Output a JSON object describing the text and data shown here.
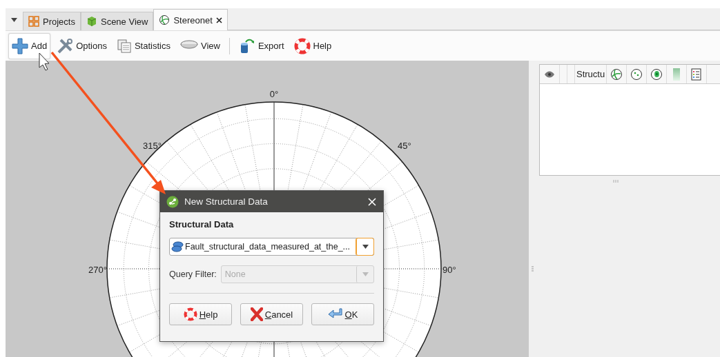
{
  "tabs": [
    {
      "label": "Projects",
      "kind": "projects",
      "selected": false
    },
    {
      "label": "Scene View",
      "kind": "scene",
      "selected": false
    },
    {
      "label": "Stereonet",
      "kind": "stereonet",
      "selected": true
    }
  ],
  "toolbar": [
    {
      "label": "Add",
      "kind": "add",
      "hovered": true,
      "separator_before": false
    },
    {
      "label": "Options",
      "kind": "options",
      "hovered": false,
      "separator_before": false
    },
    {
      "label": "Statistics",
      "kind": "statistics",
      "hovered": false,
      "separator_before": false
    },
    {
      "label": "View",
      "kind": "view",
      "hovered": false,
      "separator_before": false
    },
    {
      "label": "Export",
      "kind": "export",
      "hovered": false,
      "separator_before": true
    },
    {
      "label": "Help",
      "kind": "help",
      "hovered": false,
      "separator_before": false
    }
  ],
  "stereonet": {
    "labels": [
      {
        "text": "0°",
        "kind": "n"
      },
      {
        "text": "45°",
        "kind": "ne"
      },
      {
        "text": "315°",
        "kind": "nw"
      },
      {
        "text": "270°",
        "kind": "w"
      },
      {
        "text": "90°",
        "kind": "e"
      }
    ]
  },
  "side_panel": {
    "header": "Structu"
  },
  "dialog": {
    "title": "New Structural Data",
    "section": "Structural Data",
    "structural_data": {
      "value": "Fault_structural_data_measured_at_the_..."
    },
    "query_filter": {
      "label": "Query Filter:",
      "value": "None",
      "disabled": true
    },
    "buttons": [
      {
        "label": "Help",
        "kind": "help"
      },
      {
        "label": "Cancel",
        "kind": "cancel"
      },
      {
        "label": "OK",
        "kind": "ok"
      }
    ]
  }
}
